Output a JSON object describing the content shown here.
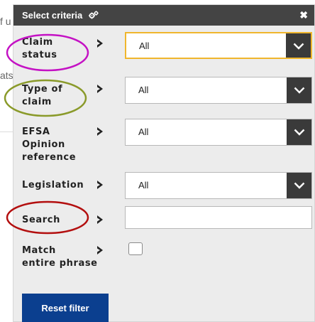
{
  "background": {
    "text_fragment_1": "f u",
    "text_fragment_2": "ats"
  },
  "panel": {
    "title": "Select criteria",
    "title_icon": "gears-icon",
    "close_icon": "close-icon"
  },
  "filters": {
    "claim_status": {
      "label_line1": "Claim",
      "label_line2": "status",
      "value": "All"
    },
    "type_of_claim": {
      "label_line1": "Type of",
      "label_line2": "claim",
      "value": "All"
    },
    "efsa_opinion": {
      "label_line1": "EFSA",
      "label_line2": "Opinion",
      "label_line3": "reference",
      "value": "All"
    },
    "legislation": {
      "label": "Legislation",
      "value": "All"
    },
    "search": {
      "label": "Search",
      "value": "",
      "placeholder": ""
    },
    "match_phrase": {
      "label_line1": "Match",
      "label_line2": "entire phrase",
      "checked": false
    }
  },
  "reset_button": {
    "label": "Reset filter"
  },
  "colors": {
    "header": "#444444",
    "panel_bg": "#ececec",
    "dropdown_arrow_bg": "#3a3a3a",
    "focus_border": "#f0b62d",
    "reset_button": "#0b3f8f",
    "annotation_magenta": "#c412c4",
    "annotation_olive": "#8a9a2a",
    "annotation_red": "#b30f0f"
  }
}
